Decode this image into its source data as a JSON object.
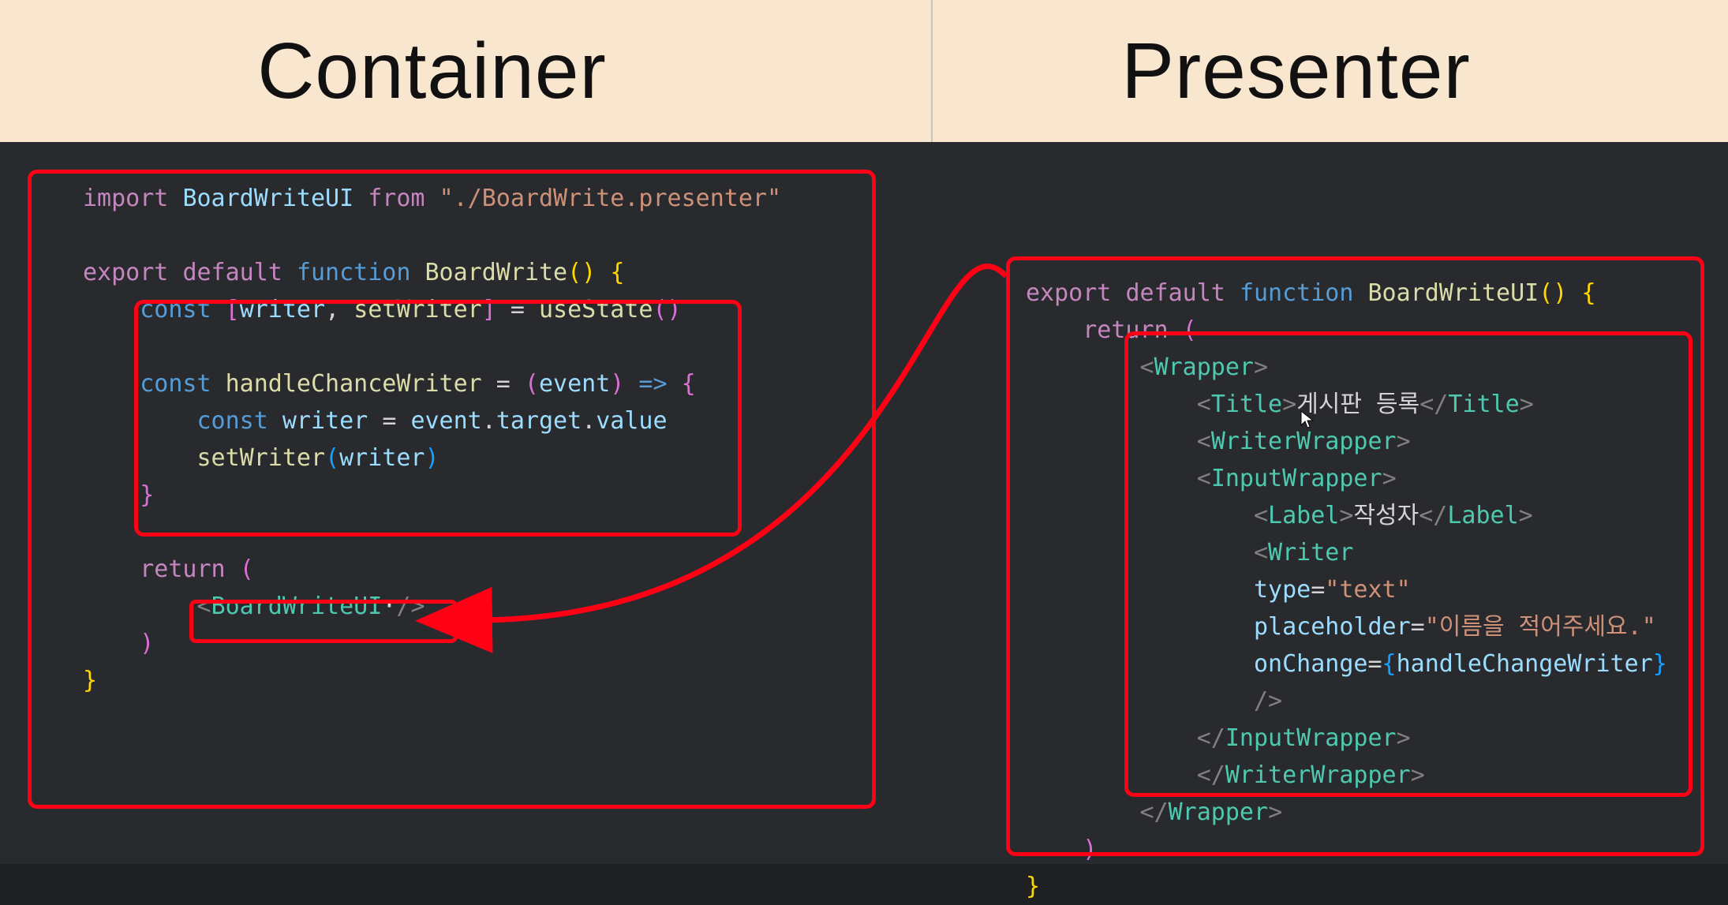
{
  "header": {
    "left_title": "Container",
    "right_title": "Presenter"
  },
  "container_code": {
    "l1_import": "import",
    "l1_idents": "BoardWriteUI",
    "l1_from": "from",
    "l1_path": "\"./BoardWrite.presenter\"",
    "l3_export": "export",
    "l3_default": "default",
    "l3_function": "function",
    "l3_fname": "BoardWrite",
    "l4_const": "const",
    "l4_arr_open": "[",
    "l4_writer": "writer",
    "l4_comma": ",",
    "l4_setWriter": "setWriter",
    "l4_arr_close": "]",
    "l4_eq": "=",
    "l4_useState": "useState",
    "l6_const": "const",
    "l6_fname": "handleChanceWriter",
    "l6_eq": "=",
    "l6_event": "event",
    "l6_arrow": "=>",
    "l7_const": "const",
    "l7_writer": "writer",
    "l7_eq": "=",
    "l7_event": "event",
    "l7_target": "target",
    "l7_value": "value",
    "l8_setWriter": "setWriter",
    "l8_writer": "writer",
    "l11_return": "return",
    "l12_tag": "BoardWriteUI",
    "l12_dot": "·"
  },
  "presenter_code": {
    "l1_export": "export",
    "l1_default": "default",
    "l1_function": "function",
    "l1_fname": "BoardWriteUI",
    "l2_return": "return",
    "l3_Wrapper": "Wrapper",
    "l4_Title": "Title",
    "l4_TitleText": "게시판 등록",
    "l5_WriterWrapper": "WriterWrapper",
    "l6_InputWrapper": "InputWrapper",
    "l7_Label": "Label",
    "l7_LabelText": "작성자",
    "l8_Writer": "Writer",
    "l9_attr_type": "type",
    "l9_val_type": "\"text\"",
    "l10_attr_ph": "placeholder",
    "l10_val_ph": "\"이름을 적어주세요.\"",
    "l11_attr_oc": "onChange",
    "l11_val_oc": "handleChangeWriter",
    "l12_slash": "/>",
    "l13_InputWrapper_c": "InputWrapper",
    "l14_WriterWrapper_c": "WriterWrapper",
    "l15_Wrapper_c": "Wrapper"
  }
}
